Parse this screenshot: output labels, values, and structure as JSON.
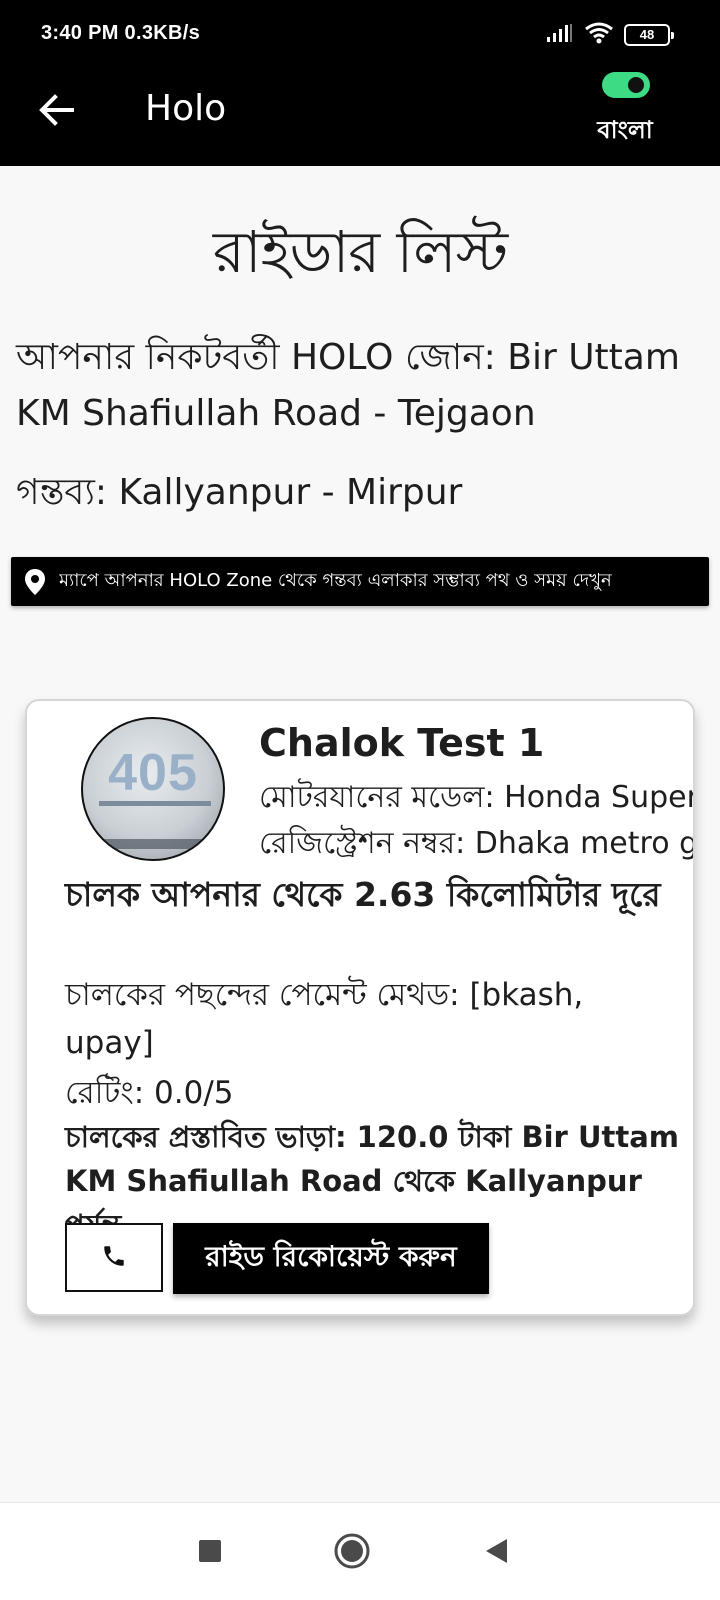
{
  "status_bar": {
    "time": "3:40 PM  0.3KB/s",
    "battery": "48"
  },
  "app_bar": {
    "title": "Holo",
    "language_toggle_label": "বাংলা",
    "language_toggle_on": true
  },
  "page": {
    "title": "রাইডার লিস্ট",
    "zone_line": "আপনার নিকটবর্তী HOLO জোন: Bir Uttam KM Shafiullah Road - Tejgaon",
    "destination_line": "গন্তব্য: Kallyanpur - Mirpur",
    "map_banner_text": "ম্যাপে আপনার HOLO Zone থেকে গন্তব্য এলাকার সম্ভাব্য পথ ও সময় দেখুন"
  },
  "rider_card": {
    "avatar_plate_text": "405",
    "driver_name": "Chalok Test 1",
    "vehicle_model": "মোটরযানের মডেল: Honda Super",
    "registration": "রেজিস্ট্রেশন নম্বর: Dhaka metro g",
    "distance": "চালক আপনার থেকে 2.63 কিলোমিটার দূরে",
    "payment_methods": "চালকের পছন্দের পেমেন্ট মেথড: [bkash, upay]",
    "rating": "রেটিং: 0.0/5",
    "fare": "চালকের প্রস্তাবিত ভাড়া: 120.0 টাকা Bir Uttam KM Shafiullah Road থেকে Kallyanpur পর্যন্ত",
    "request_button_label": "রাইড রিকোয়েস্ট করুন"
  },
  "colors": {
    "app_bar": "#000000",
    "toggle_on": "#3ddc84",
    "card_border": "#d6d6d6"
  }
}
